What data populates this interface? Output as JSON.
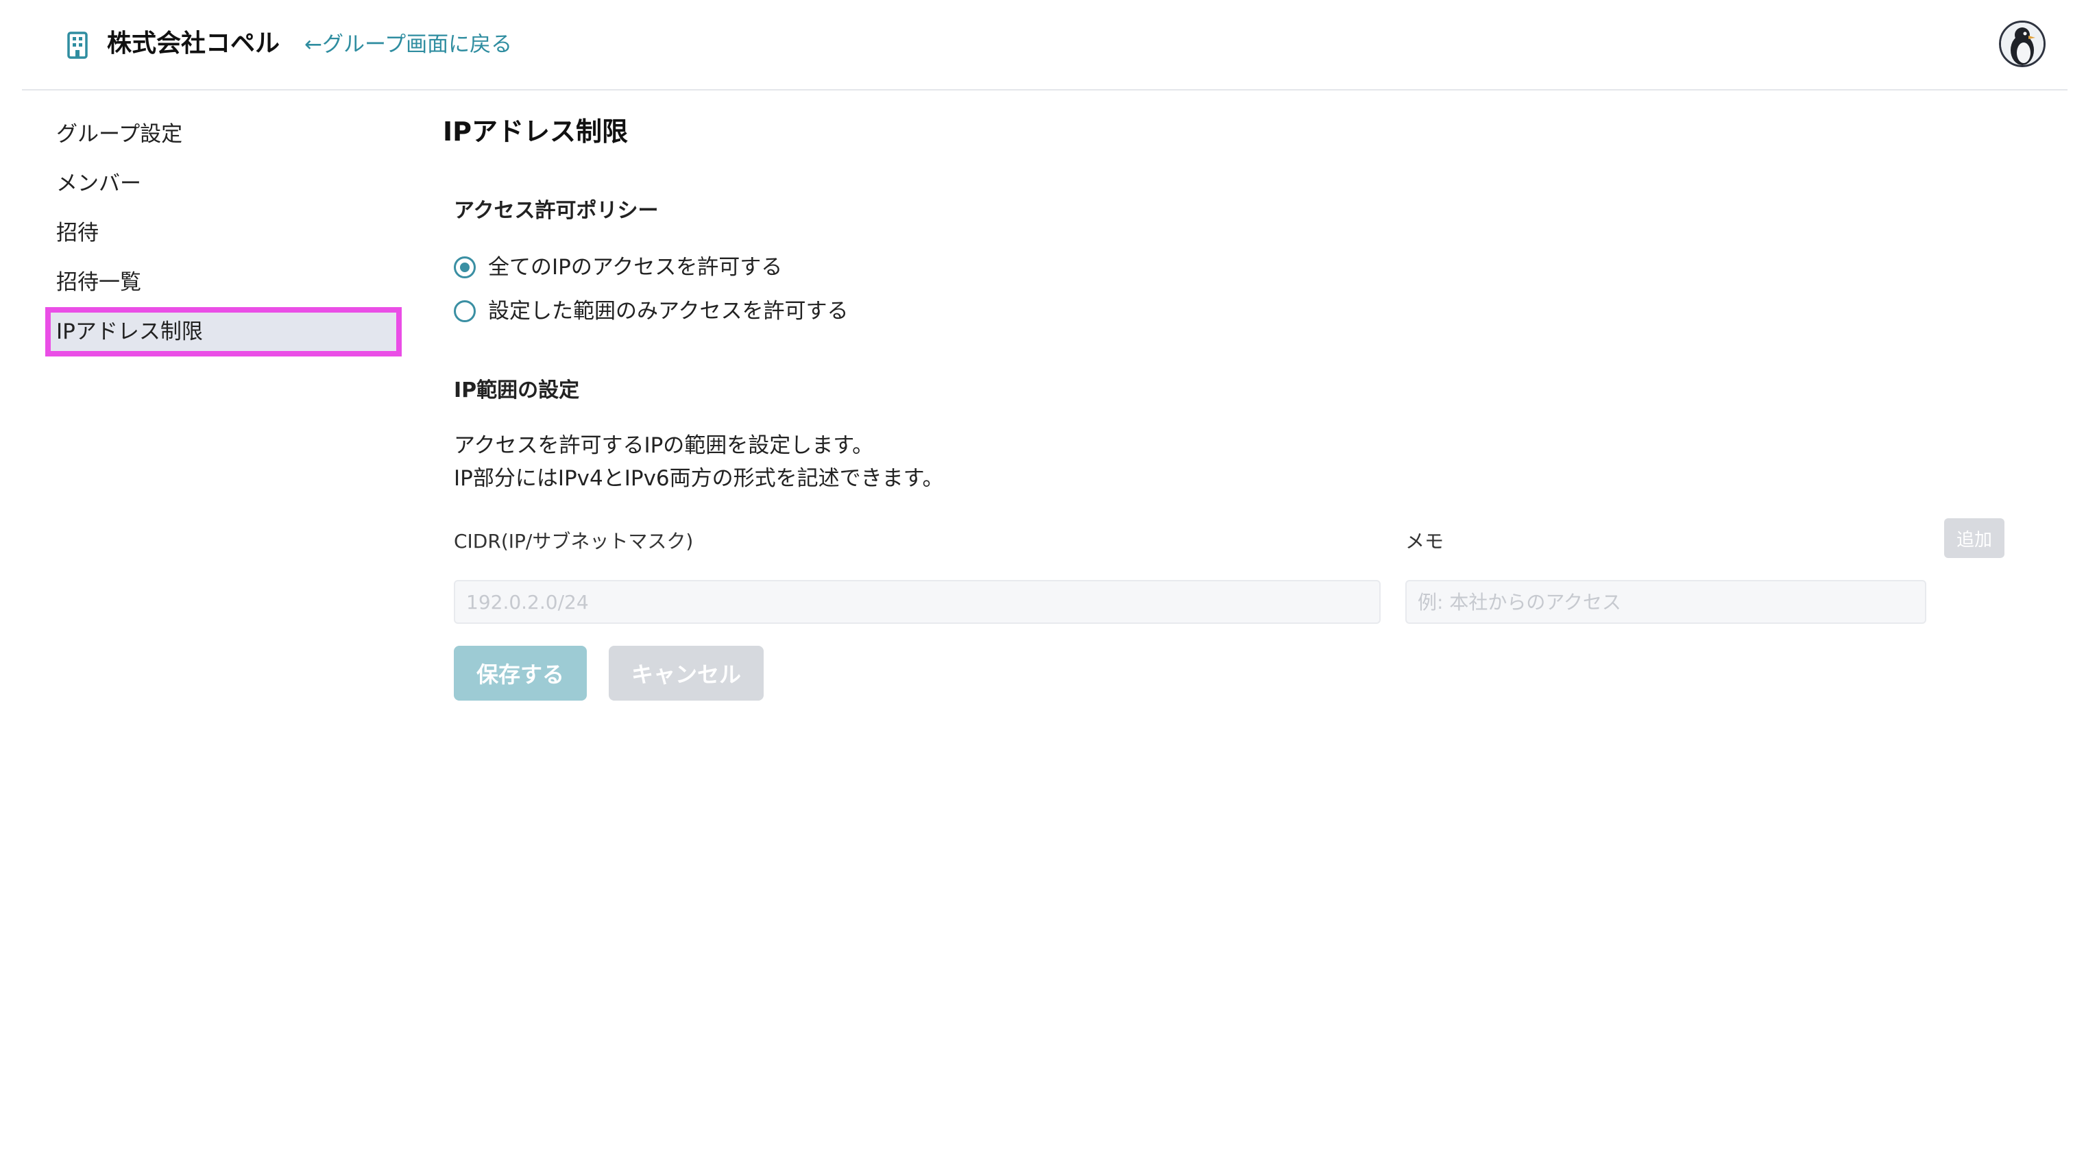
{
  "header": {
    "org_icon": "building-icon",
    "org_name": "株式会社コペル",
    "back_link": "←グループ画面に戻る",
    "avatar_icon": "penguin-avatar-icon",
    "accent_color": "#2f8da0"
  },
  "sidebar": {
    "items": [
      {
        "label": "グループ設定",
        "active": false
      },
      {
        "label": "メンバー",
        "active": false
      },
      {
        "label": "招待",
        "active": false
      },
      {
        "label": "招待一覧",
        "active": false
      },
      {
        "label": "IPアドレス制限",
        "active": true
      }
    ],
    "highlight_color": "#ea4ee6"
  },
  "main": {
    "title": "IPアドレス制限",
    "policy": {
      "title": "アクセス許可ポリシー",
      "options": [
        {
          "label": "全てのIPのアクセスを許可する",
          "selected": true
        },
        {
          "label": "設定した範囲のみアクセスを許可する",
          "selected": false
        }
      ]
    },
    "range": {
      "title": "IP範囲の設定",
      "description_line1": "アクセスを許可するIPの範囲を設定します。",
      "description_line2": "IP部分にはIPv4とIPv6両方の形式を記述できます。",
      "cidr_label": "CIDR(IP/サブネットマスク)",
      "cidr_value": "",
      "cidr_placeholder": "192.0.2.0/24",
      "memo_label": "メモ",
      "memo_value": "",
      "memo_placeholder": "例: 本社からのアクセス",
      "add_label": "追加"
    },
    "actions": {
      "save_label": "保存する",
      "cancel_label": "キャンセル"
    }
  }
}
